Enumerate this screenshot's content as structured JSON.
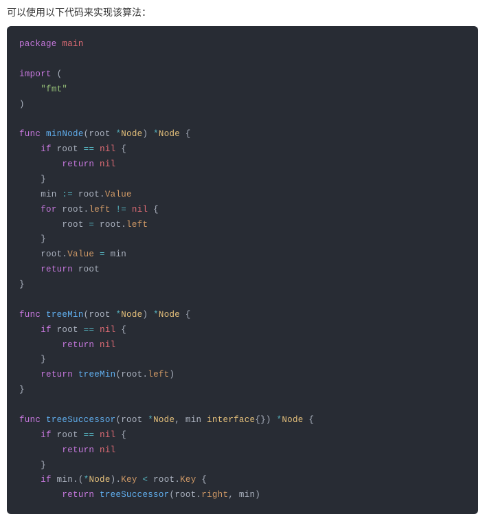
{
  "intro": "可以使用以下代码来实现该算法：",
  "code": {
    "tokens": [
      [
        [
          "kw",
          "package"
        ],
        [
          "plain",
          " "
        ],
        [
          "ident",
          "main"
        ]
      ],
      [],
      [
        [
          "kw",
          "import"
        ],
        [
          "plain",
          " ("
        ]
      ],
      [
        [
          "plain",
          "    "
        ],
        [
          "str",
          "\"fmt\""
        ]
      ],
      [
        [
          "plain",
          ")"
        ]
      ],
      [],
      [
        [
          "kw",
          "func"
        ],
        [
          "plain",
          " "
        ],
        [
          "fn",
          "minNode"
        ],
        [
          "plain",
          "(root "
        ],
        [
          "op",
          "*"
        ],
        [
          "type",
          "Node"
        ],
        [
          "plain",
          ") "
        ],
        [
          "op",
          "*"
        ],
        [
          "type",
          "Node"
        ],
        [
          "plain",
          " {"
        ]
      ],
      [
        [
          "plain",
          "    "
        ],
        [
          "kw",
          "if"
        ],
        [
          "plain",
          " root "
        ],
        [
          "op",
          "=="
        ],
        [
          "plain",
          " "
        ],
        [
          "ident",
          "nil"
        ],
        [
          "plain",
          " {"
        ]
      ],
      [
        [
          "plain",
          "        "
        ],
        [
          "kw",
          "return"
        ],
        [
          "plain",
          " "
        ],
        [
          "ident",
          "nil"
        ]
      ],
      [
        [
          "plain",
          "    }"
        ]
      ],
      [
        [
          "plain",
          "    min "
        ],
        [
          "op",
          ":="
        ],
        [
          "plain",
          " root."
        ],
        [
          "attr",
          "Value"
        ]
      ],
      [
        [
          "plain",
          "    "
        ],
        [
          "kw",
          "for"
        ],
        [
          "plain",
          " root."
        ],
        [
          "attr",
          "left"
        ],
        [
          "plain",
          " "
        ],
        [
          "op",
          "!="
        ],
        [
          "plain",
          " "
        ],
        [
          "ident",
          "nil"
        ],
        [
          "plain",
          " {"
        ]
      ],
      [
        [
          "plain",
          "        root "
        ],
        [
          "op",
          "="
        ],
        [
          "plain",
          " root."
        ],
        [
          "attr",
          "left"
        ]
      ],
      [
        [
          "plain",
          "    }"
        ]
      ],
      [
        [
          "plain",
          "    root."
        ],
        [
          "attr",
          "Value"
        ],
        [
          "plain",
          " "
        ],
        [
          "op",
          "="
        ],
        [
          "plain",
          " min"
        ]
      ],
      [
        [
          "plain",
          "    "
        ],
        [
          "kw",
          "return"
        ],
        [
          "plain",
          " root"
        ]
      ],
      [
        [
          "plain",
          "}"
        ]
      ],
      [],
      [
        [
          "kw",
          "func"
        ],
        [
          "plain",
          " "
        ],
        [
          "fn",
          "treeMin"
        ],
        [
          "plain",
          "(root "
        ],
        [
          "op",
          "*"
        ],
        [
          "type",
          "Node"
        ],
        [
          "plain",
          ") "
        ],
        [
          "op",
          "*"
        ],
        [
          "type",
          "Node"
        ],
        [
          "plain",
          " {"
        ]
      ],
      [
        [
          "plain",
          "    "
        ],
        [
          "kw",
          "if"
        ],
        [
          "plain",
          " root "
        ],
        [
          "op",
          "=="
        ],
        [
          "plain",
          " "
        ],
        [
          "ident",
          "nil"
        ],
        [
          "plain",
          " {"
        ]
      ],
      [
        [
          "plain",
          "        "
        ],
        [
          "kw",
          "return"
        ],
        [
          "plain",
          " "
        ],
        [
          "ident",
          "nil"
        ]
      ],
      [
        [
          "plain",
          "    }"
        ]
      ],
      [
        [
          "plain",
          "    "
        ],
        [
          "kw",
          "return"
        ],
        [
          "plain",
          " "
        ],
        [
          "fn",
          "treeMin"
        ],
        [
          "plain",
          "(root."
        ],
        [
          "attr",
          "left"
        ],
        [
          "plain",
          ")"
        ]
      ],
      [
        [
          "plain",
          "}"
        ]
      ],
      [],
      [
        [
          "kw",
          "func"
        ],
        [
          "plain",
          " "
        ],
        [
          "fn",
          "treeSuccessor"
        ],
        [
          "plain",
          "(root "
        ],
        [
          "op",
          "*"
        ],
        [
          "type",
          "Node"
        ],
        [
          "plain",
          ", min "
        ],
        [
          "type",
          "interface"
        ],
        [
          "plain",
          "{}) "
        ],
        [
          "op",
          "*"
        ],
        [
          "type",
          "Node"
        ],
        [
          "plain",
          " {"
        ]
      ],
      [
        [
          "plain",
          "    "
        ],
        [
          "kw",
          "if"
        ],
        [
          "plain",
          " root "
        ],
        [
          "op",
          "=="
        ],
        [
          "plain",
          " "
        ],
        [
          "ident",
          "nil"
        ],
        [
          "plain",
          " {"
        ]
      ],
      [
        [
          "plain",
          "        "
        ],
        [
          "kw",
          "return"
        ],
        [
          "plain",
          " "
        ],
        [
          "ident",
          "nil"
        ]
      ],
      [
        [
          "plain",
          "    }"
        ]
      ],
      [
        [
          "plain",
          "    "
        ],
        [
          "kw",
          "if"
        ],
        [
          "plain",
          " min.("
        ],
        [
          "op",
          "*"
        ],
        [
          "type",
          "Node"
        ],
        [
          "plain",
          ")."
        ],
        [
          "attr",
          "Key"
        ],
        [
          "plain",
          " "
        ],
        [
          "op",
          "<"
        ],
        [
          "plain",
          " root."
        ],
        [
          "attr",
          "Key"
        ],
        [
          "plain",
          " {"
        ]
      ],
      [
        [
          "plain",
          "        "
        ],
        [
          "kw",
          "return"
        ],
        [
          "plain",
          " "
        ],
        [
          "fn",
          "treeSuccessor"
        ],
        [
          "plain",
          "(root."
        ],
        [
          "attr",
          "right"
        ],
        [
          "plain",
          ", min)"
        ]
      ]
    ]
  }
}
